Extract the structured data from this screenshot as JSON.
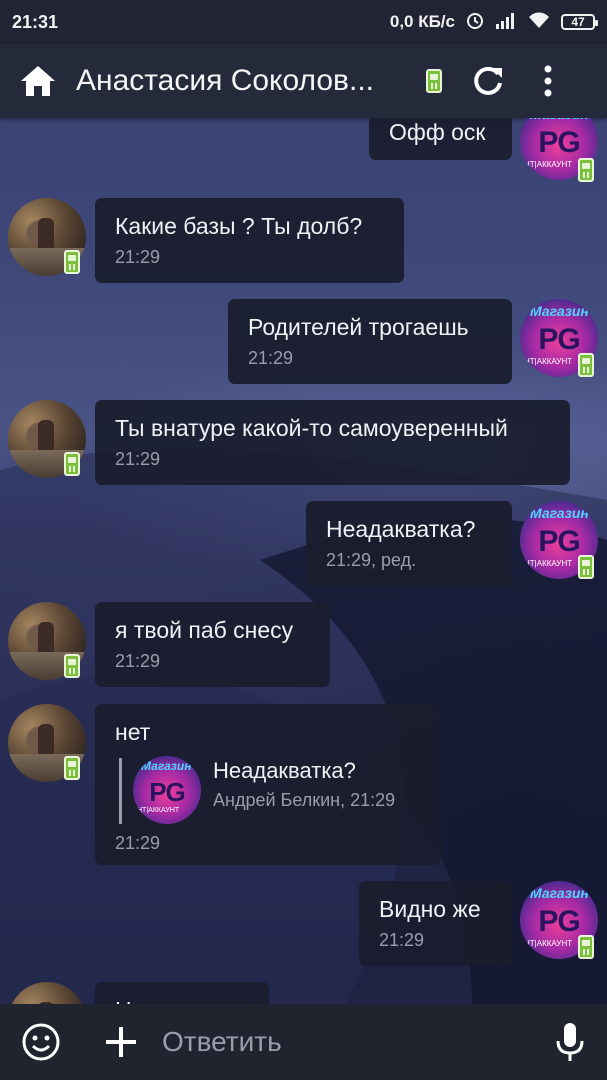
{
  "status_bar": {
    "time": "21:31",
    "network_speed": "0,0 КБ/с",
    "battery": "47"
  },
  "app_bar": {
    "title": "Анастасия Соколов..."
  },
  "messages": [
    {
      "id": "m1",
      "direction": "out",
      "text": "Офф оск",
      "meta": ""
    },
    {
      "id": "m2",
      "direction": "in",
      "text": "Какие базы ? Ты долб?",
      "meta": "21:29"
    },
    {
      "id": "m3",
      "direction": "out",
      "text": "Родителей трогаешь",
      "meta": "21:29"
    },
    {
      "id": "m4",
      "direction": "in",
      "text": "Ты внатуре какой-то самоуверенный",
      "meta": "21:29"
    },
    {
      "id": "m5",
      "direction": "out",
      "text": "Неадакватка?",
      "meta": "21:29, ред."
    },
    {
      "id": "m6",
      "direction": "in",
      "text": "я твой паб снесу",
      "meta": "21:29"
    },
    {
      "id": "m7",
      "direction": "in",
      "text": "нет",
      "meta": "21:29",
      "reply": {
        "text": "Неадакватка?",
        "meta": "Андрей Белкин, 21:29"
      }
    },
    {
      "id": "m8",
      "direction": "out",
      "text": "Видно же",
      "meta": "21:29"
    },
    {
      "id": "m9",
      "direction": "in",
      "text": "Н",
      "meta": ""
    }
  ],
  "avatar_labels": {
    "brand": "PG",
    "top": "Магазин",
    "bottom": "НТ|АККАУНТ"
  },
  "input": {
    "placeholder": "Ответить"
  },
  "icons": [
    "home-icon",
    "mobile-icon",
    "refresh-icon",
    "more-vert-icon",
    "emoji-icon",
    "plus-icon",
    "mic-icon"
  ]
}
